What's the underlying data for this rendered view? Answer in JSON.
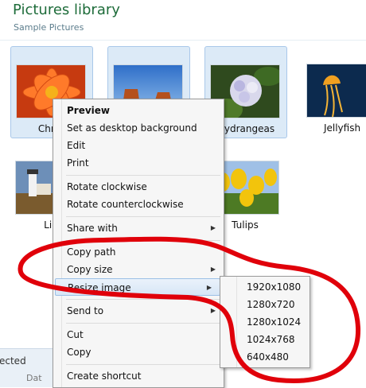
{
  "header": {
    "title": "Pictures library",
    "subtitle": "Sample Pictures"
  },
  "tiles": [
    {
      "label": "Chrys",
      "thumb": "flower-orange",
      "selected": true
    },
    {
      "label": "",
      "thumb": "desert",
      "selected": true
    },
    {
      "label": "Hydrangeas",
      "thumb": "hydrangea",
      "selected": true
    },
    {
      "label": "Jellyfish",
      "thumb": "jellyfish",
      "selected": false
    },
    {
      "label": "Lig",
      "thumb": "lighthouse",
      "selected": false
    },
    {
      "label": "Tulips",
      "thumb": "tulips",
      "selected": false
    }
  ],
  "context_menu": [
    {
      "label": "Preview",
      "bold": true
    },
    {
      "label": "Set as desktop background"
    },
    {
      "label": "Edit"
    },
    {
      "label": "Print"
    },
    {
      "label": "Rotate clockwise"
    },
    {
      "label": "Rotate counterclockwise"
    },
    {
      "label": "Share with",
      "submenu": true
    },
    {
      "label": "Copy path"
    },
    {
      "label": "Copy size",
      "submenu": true
    },
    {
      "label": "Resize image",
      "submenu": true,
      "highlighted": true
    },
    {
      "label": "Send to",
      "submenu": true
    },
    {
      "label": "Cut"
    },
    {
      "label": "Copy"
    },
    {
      "label": "Create shortcut"
    }
  ],
  "resize_submenu": [
    "1920x1080",
    "1280x720",
    "1280x1024",
    "1024x768",
    "640x480"
  ],
  "details_pane": {
    "status": "ected",
    "date_label": "Dat"
  },
  "colors": {
    "title": "#1e6c3a",
    "selection": "#dceaf7",
    "annotation": "#e0000a"
  }
}
